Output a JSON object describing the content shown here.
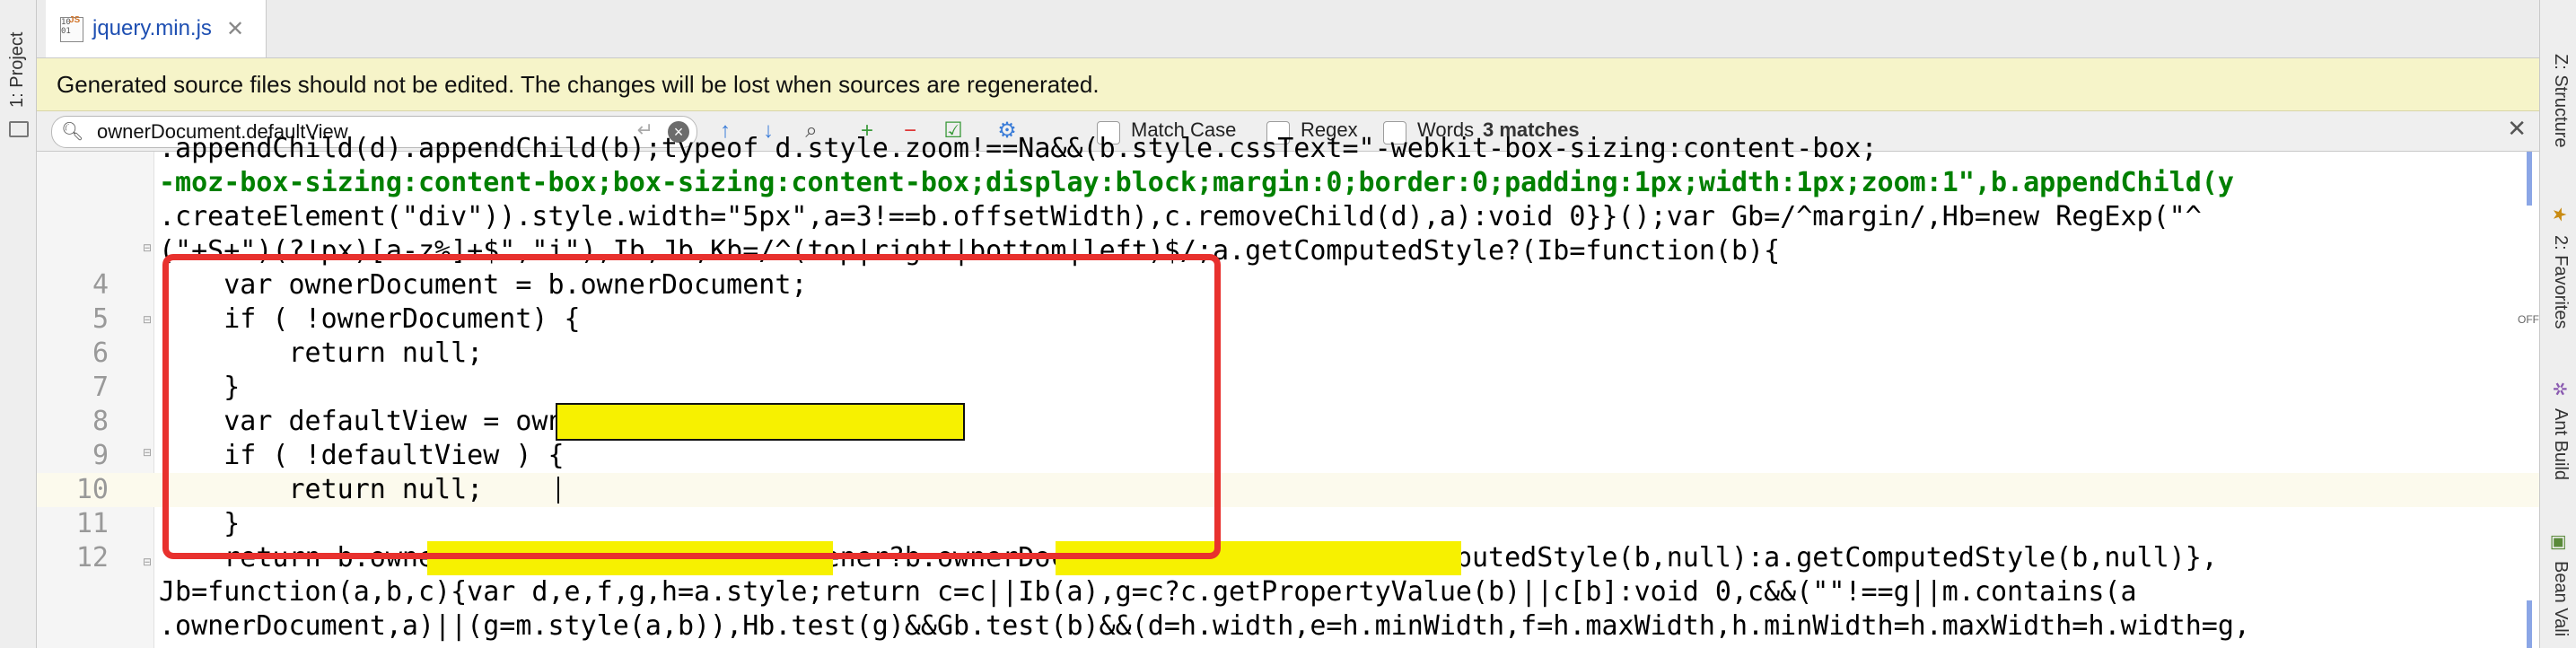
{
  "left_toolwindow": {
    "project_label": "1: Project"
  },
  "right_toolwindows": [
    "Z: Structure",
    "2: Favorites",
    "Ant Build",
    "Bean Vali"
  ],
  "tab": {
    "filename": "jquery.min.js",
    "icon": "js-file-icon",
    "icon_text": "10\n01"
  },
  "banner": {
    "text": "Generated source files should not be edited. The changes will be lost when sources are regenerated."
  },
  "search": {
    "query": "ownerDocument.defaultView",
    "options": [
      {
        "label": "Match Case",
        "checked": false
      },
      {
        "label": "Regex",
        "checked": false
      },
      {
        "label": "Words",
        "checked": false
      }
    ],
    "matches": "3 matches",
    "icons": [
      "search-history-icon",
      "enter-icon",
      "clear-icon",
      "previous-occurrence-icon",
      "next-occurrence-icon",
      "find-all-icon",
      "add-occurrence-icon",
      "remove-occurrence-icon",
      "select-all-occurrences-icon",
      "settings-icon",
      "close-icon"
    ]
  },
  "editor": {
    "off_label": "OFF",
    "pre_lines": [
      ".appendChild(d).appendChild(b);typeof d.style.zoom!==Na&&(b.style.cssText=\"-webkit-box-sizing:content-box;",
      "-moz-box-sizing:content-box;box-sizing:content-box;display:block;margin:0;border:0;padding:1px;width:1px;zoom:1\",b.appendChild(y",
      ".createElement(\"div\")).style.width=\"5px\",a=3!==b.offsetWidth),c.removeChild(d),a):void 0}}();var Gb=/^margin/,Hb=new RegExp(\"^",
      "(\"+S+\")(?!px)[a-z%]+$\",\"i\"),Ib,Jb,Kb=/^(top|right|bottom|left)$/;a.getComputedStyle?(Ib=function(b){"
    ],
    "numbered_lines": [
      {
        "n": "4",
        "text": "    var ownerDocument = b.ownerDocument;"
      },
      {
        "n": "5",
        "text": "    if ( !ownerDocument) {"
      },
      {
        "n": "6",
        "text": "        return null;"
      },
      {
        "n": "7",
        "text": "    }"
      },
      {
        "n": "8",
        "text": "    var defaultView = ownerDocument.defaultView;"
      },
      {
        "n": "9",
        "text": "    if ( !defaultView ) {"
      },
      {
        "n": "10",
        "text": "        return null;"
      },
      {
        "n": "11",
        "text": "    }"
      },
      {
        "n": "12",
        "text": "    return b.ownerDocument.defaultView.opener?b.ownerDocument.defaultView.getComputedStyle(b,null):a.getComputedStyle(b,null)},"
      }
    ],
    "post_lines": [
      "Jb=function(a,b,c){var d,e,f,g,h=a.style;return c=c||Ib(a),g=c?c.getPropertyValue(b)||c[b]:void 0,c&&(\"\"!==g||m.contains(a",
      ".ownerDocument,a)||(g=m.style(a,b)),Hb.test(g)&&Gb.test(b)&&(d=h.width,e=h.minWidth,f=h.maxWidth,h.minWidth=h.maxWidth=h.width=g,"
    ]
  },
  "colors": {
    "highlight": "#f7f100",
    "annotation_box": "#e8312e",
    "banner_bg": "#f6f4c9",
    "keyword": "#000080",
    "string": "#008000"
  }
}
